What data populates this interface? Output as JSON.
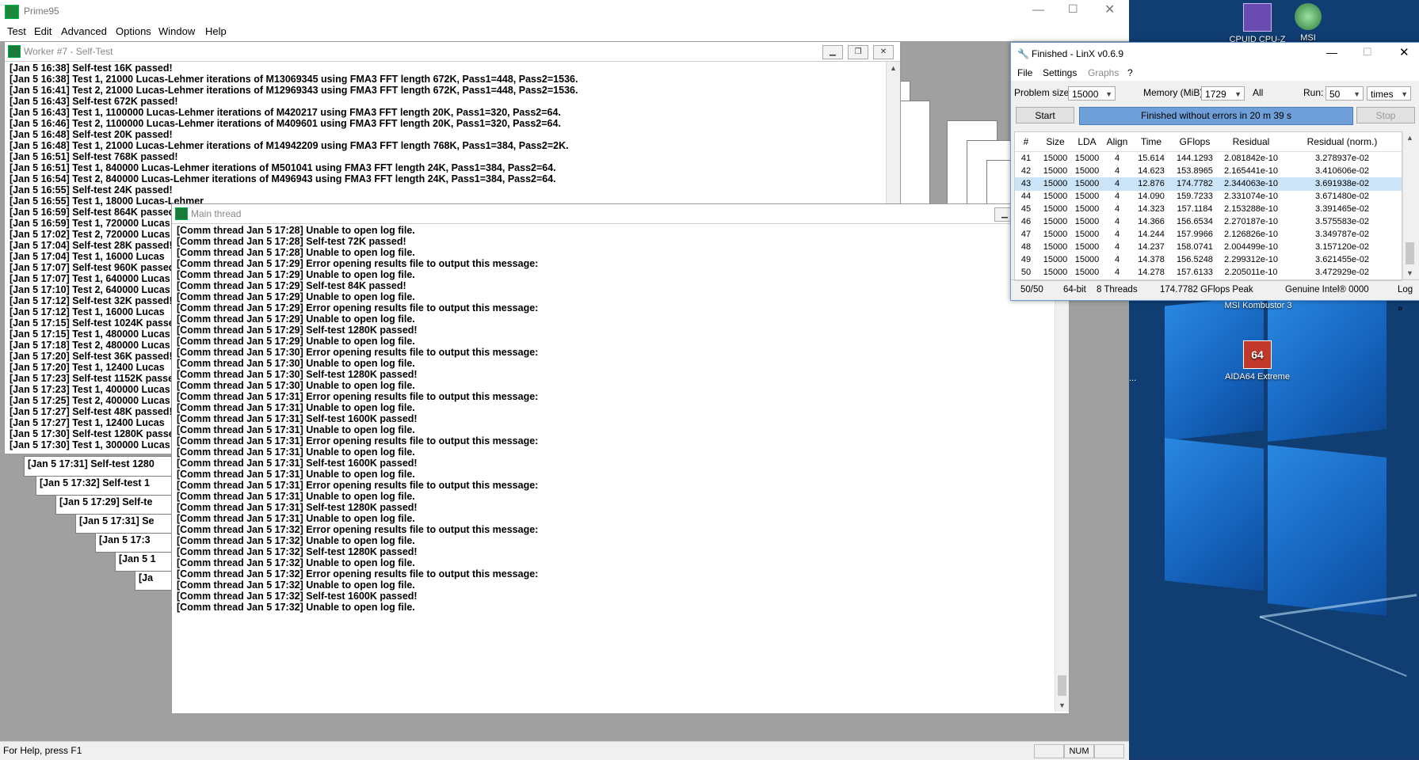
{
  "prime95": {
    "title": "Prime95",
    "menu": [
      "Test",
      "Edit",
      "Advanced",
      "Options",
      "Window",
      "Help"
    ],
    "status_text": "For Help, press F1",
    "status_num": "NUM",
    "worker7": {
      "title": "Worker #7 - Self-Test",
      "lines": [
        "[Jan 5 16:38] Self-test 16K passed!",
        "[Jan 5 16:38] Test 1, 21000 Lucas-Lehmer iterations of M13069345 using FMA3 FFT length 672K, Pass1=448, Pass2=1536.",
        "[Jan 5 16:41] Test 2, 21000 Lucas-Lehmer iterations of M12969343 using FMA3 FFT length 672K, Pass1=448, Pass2=1536.",
        "[Jan 5 16:43] Self-test 672K passed!",
        "[Jan 5 16:43] Test 1, 1100000 Lucas-Lehmer iterations of M420217 using FMA3 FFT length 20K, Pass1=320, Pass2=64.",
        "[Jan 5 16:46] Test 2, 1100000 Lucas-Lehmer iterations of M409601 using FMA3 FFT length 20K, Pass1=320, Pass2=64.",
        "[Jan 5 16:48] Self-test 20K passed!",
        "[Jan 5 16:48] Test 1, 21000 Lucas-Lehmer iterations of M14942209 using FMA3 FFT length 768K, Pass1=384, Pass2=2K.",
        "[Jan 5 16:51] Self-test 768K passed!",
        "[Jan 5 16:51] Test 1, 840000 Lucas-Lehmer iterations of M501041 using FMA3 FFT length 24K, Pass1=384, Pass2=64.",
        "[Jan 5 16:54] Test 2, 840000 Lucas-Lehmer iterations of M496943 using FMA3 FFT length 24K, Pass1=384, Pass2=64.",
        "[Jan 5 16:55] Self-test 24K passed!",
        "[Jan 5 16:55] Test 1, 18000 Lucas-Lehmer",
        "[Jan 5 16:59] Self-test 864K passed!",
        "[Jan 5 16:59] Test 1, 720000 Lucas",
        "[Jan 5 17:02] Test 2, 720000 Lucas",
        "[Jan 5 17:04] Self-test 28K passed!",
        "[Jan 5 17:04] Test 1, 16000 Lucas",
        "[Jan 5 17:07] Self-test 960K passed!",
        "[Jan 5 17:07] Test 1, 640000 Lucas",
        "[Jan 5 17:10] Test 2, 640000 Lucas",
        "[Jan 5 17:12] Self-test 32K passed!",
        "[Jan 5 17:12] Test 1, 16000 Lucas",
        "[Jan 5 17:15] Self-test 1024K passed!",
        "[Jan 5 17:15] Test 1, 480000 Lucas",
        "[Jan 5 17:18] Test 2, 480000 Lucas",
        "[Jan 5 17:20] Self-test 36K passed!",
        "[Jan 5 17:20] Test 1, 12400 Lucas",
        "[Jan 5 17:23] Self-test 1152K passed!",
        "[Jan 5 17:23] Test 1, 400000 Lucas",
        "[Jan 5 17:25] Test 2, 400000 Lucas",
        "[Jan 5 17:27] Self-test 48K passed!",
        "[Jan 5 17:27] Test 1, 12400 Lucas",
        "[Jan 5 17:30] Self-test 1280K passed!",
        "[Jan 5 17:30] Test 1, 300000 Lucas"
      ]
    },
    "stacked_windows": [
      "[Jan 5 17:31] Self-test 1280",
      "[Jan 5 17:32] Self-test 1",
      "[Jan 5 17:29] Self-te",
      "[Jan 5 17:31] Se",
      "[Jan 5 17:3",
      "[Jan 5 1",
      "[Ja"
    ],
    "main_thread": {
      "title": "Main thread",
      "lines": [
        "[Comm thread Jan 5 17:28] Unable to open log file.",
        "[Comm thread Jan 5 17:28] Self-test 72K passed!",
        "[Comm thread Jan 5 17:28] Unable to open log file.",
        "[Comm thread Jan 5 17:29] Error opening results file to output this message:",
        "[Comm thread Jan 5 17:29] Unable to open log file.",
        "[Comm thread Jan 5 17:29] Self-test 84K passed!",
        "[Comm thread Jan 5 17:29] Unable to open log file.",
        "[Comm thread Jan 5 17:29] Error opening results file to output this message:",
        "[Comm thread Jan 5 17:29] Unable to open log file.",
        "[Comm thread Jan 5 17:29] Self-test 1280K passed!",
        "[Comm thread Jan 5 17:29] Unable to open log file.",
        "[Comm thread Jan 5 17:30] Error opening results file to output this message:",
        "[Comm thread Jan 5 17:30] Unable to open log file.",
        "[Comm thread Jan 5 17:30] Self-test 1280K passed!",
        "[Comm thread Jan 5 17:30] Unable to open log file.",
        "[Comm thread Jan 5 17:31] Error opening results file to output this message:",
        "[Comm thread Jan 5 17:31] Unable to open log file.",
        "[Comm thread Jan 5 17:31] Self-test 1600K passed!",
        "[Comm thread Jan 5 17:31] Unable to open log file.",
        "[Comm thread Jan 5 17:31] Error opening results file to output this message:",
        "[Comm thread Jan 5 17:31] Unable to open log file.",
        "[Comm thread Jan 5 17:31] Self-test 1600K passed!",
        "[Comm thread Jan 5 17:31] Unable to open log file.",
        "[Comm thread Jan 5 17:31] Error opening results file to output this message:",
        "[Comm thread Jan 5 17:31] Unable to open log file.",
        "[Comm thread Jan 5 17:31] Self-test 1280K passed!",
        "[Comm thread Jan 5 17:31] Unable to open log file.",
        "[Comm thread Jan 5 17:32] Error opening results file to output this message:",
        "[Comm thread Jan 5 17:32] Unable to open log file.",
        "[Comm thread Jan 5 17:32] Self-test 1280K passed!",
        "[Comm thread Jan 5 17:32] Unable to open log file.",
        "[Comm thread Jan 5 17:32] Error opening results file to output this message:",
        "[Comm thread Jan 5 17:32] Unable to open log file.",
        "[Comm thread Jan 5 17:32] Self-test 1600K passed!",
        "[Comm thread Jan 5 17:32] Unable to open log file."
      ]
    }
  },
  "linx": {
    "title": "Finished - LinX v0.6.9",
    "menu": [
      "File",
      "Settings",
      "Graphs",
      "?"
    ],
    "problem_size_label": "Problem size:",
    "problem_size": "15000",
    "memory_label": "Memory (MiB):",
    "memory": "1729",
    "all_label": "All",
    "run_label": "Run:",
    "run": "50",
    "times": "times",
    "start": "Start",
    "status_bar_text": "Finished without errors in 20 m 39 s",
    "stop": "Stop",
    "columns": [
      "#",
      "Size",
      "LDA",
      "Align",
      "Time",
      "GFlops",
      "Residual",
      "Residual (norm.)"
    ],
    "rows": [
      [
        "41",
        "15000",
        "15000",
        "4",
        "15.614",
        "144.1293",
        "2.081842e-10",
        "3.278937e-02"
      ],
      [
        "42",
        "15000",
        "15000",
        "4",
        "14.623",
        "153.8965",
        "2.165441e-10",
        "3.410606e-02"
      ],
      [
        "43",
        "15000",
        "15000",
        "4",
        "12.876",
        "174.7782",
        "2.344063e-10",
        "3.691938e-02"
      ],
      [
        "44",
        "15000",
        "15000",
        "4",
        "14.090",
        "159.7233",
        "2.331074e-10",
        "3.671480e-02"
      ],
      [
        "45",
        "15000",
        "15000",
        "4",
        "14.323",
        "157.1184",
        "2.153288e-10",
        "3.391465e-02"
      ],
      [
        "46",
        "15000",
        "15000",
        "4",
        "14.366",
        "156.6534",
        "2.270187e-10",
        "3.575583e-02"
      ],
      [
        "47",
        "15000",
        "15000",
        "4",
        "14.244",
        "157.9966",
        "2.126826e-10",
        "3.349787e-02"
      ],
      [
        "48",
        "15000",
        "15000",
        "4",
        "14.237",
        "158.0741",
        "2.004499e-10",
        "3.157120e-02"
      ],
      [
        "49",
        "15000",
        "15000",
        "4",
        "14.378",
        "156.5248",
        "2.299312e-10",
        "3.621455e-02"
      ],
      [
        "50",
        "15000",
        "15000",
        "4",
        "14.278",
        "157.6133",
        "2.205011e-10",
        "3.472929e-02"
      ]
    ],
    "status": {
      "progress": "50/50",
      "bits": "64-bit",
      "threads": "8 Threads",
      "peak": "174.7782 GFlops Peak",
      "cpu": "Genuine Intel® 0000",
      "log": "Log »"
    }
  },
  "desktop": {
    "icons": [
      {
        "label": "CPUID CPU-Z"
      },
      {
        "label": "MSI"
      },
      {
        "label": "MSI Kombustor 3"
      },
      {
        "label": "AIDA64 Extreme"
      }
    ],
    "partial_label": "..."
  },
  "colors": {
    "desktop_bg": "#103e73",
    "linx_progress": "#6e9fd8",
    "selected_row": "#cce4f7"
  }
}
